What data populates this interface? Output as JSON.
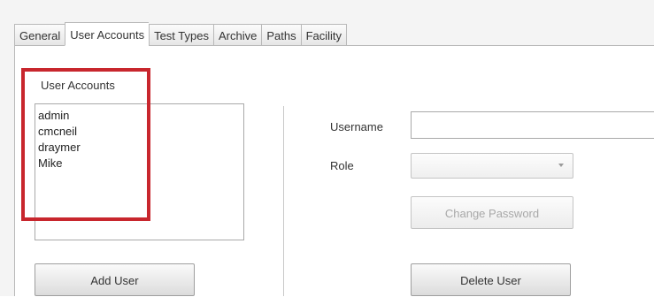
{
  "tabs": [
    {
      "label": "General"
    },
    {
      "label": "User Accounts",
      "active": true
    },
    {
      "label": "Test Types"
    },
    {
      "label": "Archive"
    },
    {
      "label": "Paths"
    },
    {
      "label": "Facility"
    }
  ],
  "user_accounts": {
    "title": "User Accounts",
    "users": [
      "admin",
      "cmcneil",
      "draymer",
      "Mike"
    ],
    "add_user_label": "Add User"
  },
  "form": {
    "username_label": "Username",
    "username_value": "",
    "role_label": "Role",
    "role_value": "",
    "change_password_label": "Change Password",
    "delete_user_label": "Delete User"
  },
  "colors": {
    "highlight_border": "#c8262d"
  }
}
